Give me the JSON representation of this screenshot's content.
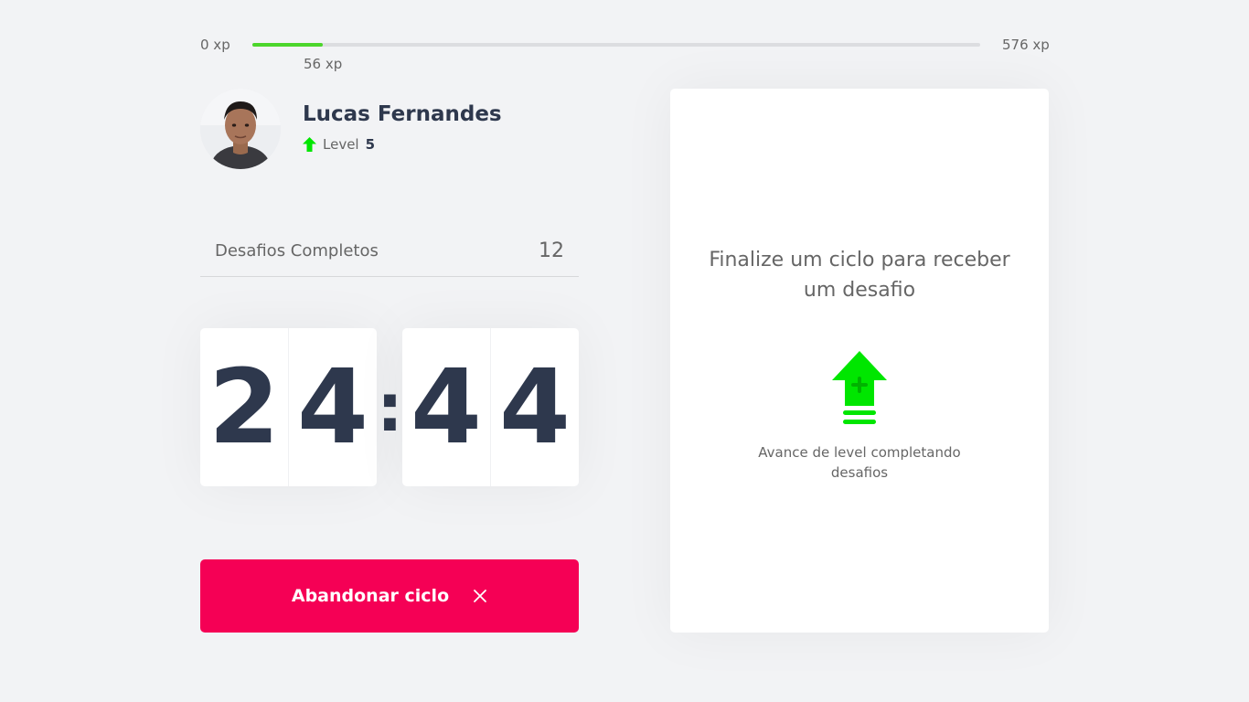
{
  "xp": {
    "min_label": "0 xp",
    "max_label": "576 xp",
    "current_label": "56 xp",
    "current": 56,
    "max": 576,
    "progress_color": "#4cd62b"
  },
  "profile": {
    "name": "Lucas Fernandes",
    "level_label": "Level",
    "level": "5",
    "avatar_icon": "user-photo"
  },
  "completed": {
    "label": "Desafios Completos",
    "value": "12"
  },
  "countdown": {
    "minute_left": "2",
    "minute_right": "4",
    "separator": ":",
    "second_left": "4",
    "second_right": "4"
  },
  "abandon": {
    "label": "Abandonar ciclo",
    "icon": "close-icon",
    "color": "#f50055"
  },
  "challenge": {
    "title": "Finalize um ciclo para receber um desafio",
    "icon": "level-up-icon",
    "hint": "Avance de level completando desafios",
    "accent": "#00e600"
  }
}
